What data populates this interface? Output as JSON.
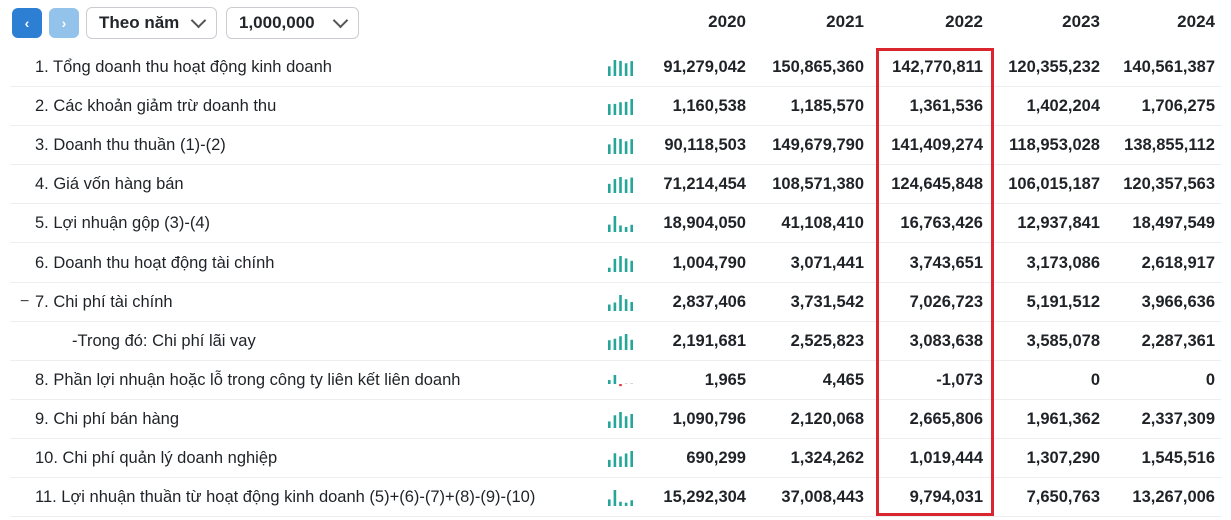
{
  "toolbar": {
    "prev_icon": "chevron-left-icon",
    "next_icon": "chevron-right-icon",
    "prev_glyph": "‹",
    "next_glyph": "›",
    "period_select": "Theo năm",
    "unit_select": "1,000,000"
  },
  "years": [
    "2020",
    "2021",
    "2022",
    "2023",
    "2024"
  ],
  "colors": {
    "accent": "#2d7fd4",
    "spark": "#26a69a",
    "negative": "#e53935",
    "highlight": "#d9262e"
  },
  "rows": [
    {
      "label": "1. Tổng doanh thu hoạt động kinh doanh",
      "values": [
        91279042,
        150865360,
        142770811,
        120355232,
        140561387
      ],
      "display": [
        "91,279,042",
        "150,865,360",
        "142,770,811",
        "120,355,232",
        "140,561,387"
      ]
    },
    {
      "label": "2. Các khoản giảm trừ doanh thu",
      "values": [
        1160538,
        1185570,
        1361536,
        1402204,
        1706275
      ],
      "display": [
        "1,160,538",
        "1,185,570",
        "1,361,536",
        "1,402,204",
        "1,706,275"
      ]
    },
    {
      "label": "3. Doanh thu thuần (1)-(2)",
      "values": [
        90118503,
        149679790,
        141409274,
        118953028,
        138855112
      ],
      "display": [
        "90,118,503",
        "149,679,790",
        "141,409,274",
        "118,953,028",
        "138,855,112"
      ]
    },
    {
      "label": "4. Giá vốn hàng bán",
      "values": [
        71214454,
        108571380,
        124645848,
        106015187,
        120357563
      ],
      "display": [
        "71,214,454",
        "108,571,380",
        "124,645,848",
        "106,015,187",
        "120,357,563"
      ]
    },
    {
      "label": "5. Lợi nhuận gộp (3)-(4)",
      "values": [
        18904050,
        41108410,
        16763426,
        12937841,
        18497549
      ],
      "display": [
        "18,904,050",
        "41,108,410",
        "16,763,426",
        "12,937,841",
        "18,497,549"
      ]
    },
    {
      "label": "6. Doanh thu hoạt động tài chính",
      "values": [
        1004790,
        3071441,
        3743651,
        3173086,
        2618917
      ],
      "display": [
        "1,004,790",
        "3,071,441",
        "3,743,651",
        "3,173,086",
        "2,618,917"
      ]
    },
    {
      "label": "7. Chi phí tài chính",
      "collapse": "−",
      "values": [
        2837406,
        3731542,
        7026723,
        5191512,
        3966636
      ],
      "display": [
        "2,837,406",
        "3,731,542",
        "7,026,723",
        "5,191,512",
        "3,966,636"
      ]
    },
    {
      "label": "-Trong đó: Chi phí lãi vay",
      "sub": true,
      "values": [
        2191681,
        2525823,
        3083638,
        3585078,
        2287361
      ],
      "display": [
        "2,191,681",
        "2,525,823",
        "3,083,638",
        "3,585,078",
        "2,287,361"
      ]
    },
    {
      "label": "8. Phần lợi nhuận hoặc lỗ trong công ty liên kết liên doanh",
      "values": [
        1965,
        4465,
        -1073,
        0,
        0
      ],
      "display": [
        "1,965",
        "4,465",
        "-1,073",
        "0",
        "0"
      ]
    },
    {
      "label": "9. Chi phí bán hàng",
      "values": [
        1090796,
        2120068,
        2665806,
        1961362,
        2337309
      ],
      "display": [
        "1,090,796",
        "2,120,068",
        "2,665,806",
        "1,961,362",
        "2,337,309"
      ]
    },
    {
      "label": "10. Chi phí quản lý doanh nghiệp",
      "values": [
        690299,
        1324262,
        1019444,
        1307290,
        1545516
      ],
      "display": [
        "690,299",
        "1,324,262",
        "1,019,444",
        "1,307,290",
        "1,545,516"
      ]
    },
    {
      "label": "11. Lợi nhuận thuần từ hoạt động kinh doanh (5)+(6)-(7)+(8)-(9)-(10)",
      "values": [
        15292304,
        37008443,
        9794031,
        7650763,
        13267006
      ],
      "display": [
        "15,292,304",
        "37,008,443",
        "9,794,031",
        "7,650,763",
        "13,267,006"
      ]
    }
  ]
}
